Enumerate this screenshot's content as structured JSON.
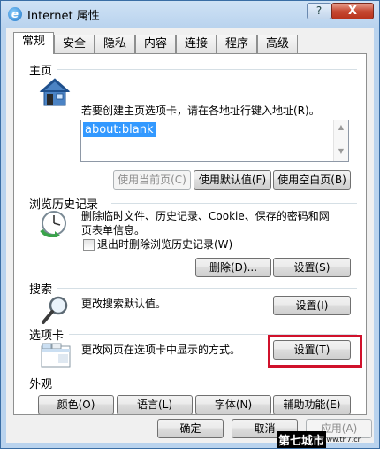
{
  "window": {
    "title": "Internet 属性",
    "help": "?",
    "close": "X"
  },
  "tabs": [
    "常规",
    "安全",
    "隐私",
    "内容",
    "连接",
    "程序",
    "高级"
  ],
  "home": {
    "heading": "主页",
    "description": "若要创建主页选项卡，请在各地址行键入地址(R)。",
    "url": "about:blank",
    "buttons": {
      "use_current": "使用当前页(C)",
      "use_default": "使用默认值(F)",
      "use_blank": "使用空白页(B)"
    }
  },
  "history": {
    "heading": "浏览历史记录",
    "description": "删除临时文件、历史记录、Cookie、保存的密码和网页表单信息。",
    "checkbox_label": "退出时删除浏览历史记录(W)",
    "checkbox_checked": false,
    "buttons": {
      "delete": "删除(D)...",
      "settings": "设置(S)"
    }
  },
  "search": {
    "heading": "搜索",
    "description": "更改搜索默认值。",
    "button": "设置(I)"
  },
  "tabs_section": {
    "heading": "选项卡",
    "description": "更改网页在选项卡中显示的方式。",
    "button": "设置(T)"
  },
  "appearance": {
    "heading": "外观",
    "buttons": {
      "colors": "颜色(O)",
      "languages": "语言(L)",
      "fonts": "字体(N)",
      "accessibility": "辅助功能(E)"
    }
  },
  "footer": {
    "ok": "确定",
    "cancel": "取消",
    "apply": "应用(A)"
  },
  "watermark": {
    "text": "第七城市",
    "url": "www.th7.cn"
  },
  "colors": {
    "highlight": "#d0112b",
    "selection": "#3399ff"
  }
}
